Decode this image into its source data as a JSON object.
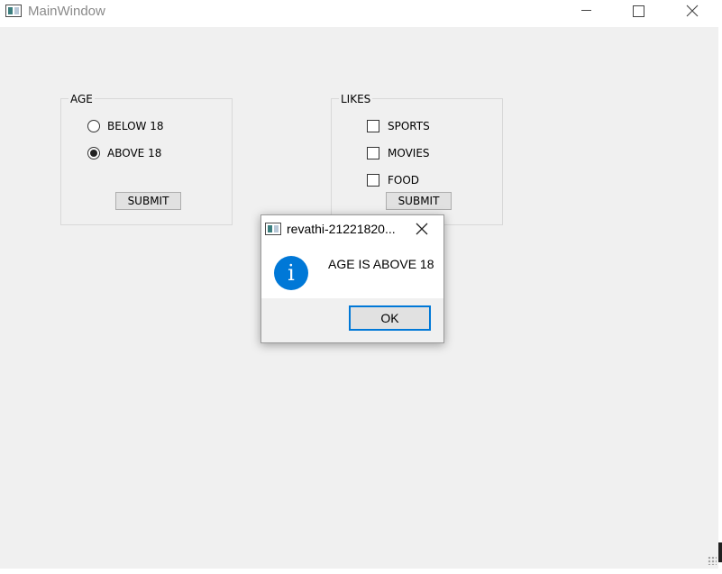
{
  "window": {
    "title": "MainWindow",
    "icon": "app-window-icon"
  },
  "age_group": {
    "title": "AGE",
    "options": [
      {
        "label": "BELOW 18",
        "checked": false
      },
      {
        "label": "ABOVE 18",
        "checked": true
      }
    ],
    "submit_label": "SUBMIT"
  },
  "likes_group": {
    "title": "LIKES",
    "options": [
      {
        "label": "SPORTS",
        "checked": false
      },
      {
        "label": "MOVIES",
        "checked": false
      },
      {
        "label": "FOOD",
        "checked": false
      }
    ],
    "submit_label": "SUBMIT"
  },
  "dialog": {
    "title": "revathi-21221820...",
    "icon": "info-icon",
    "message": "AGE IS ABOVE 18",
    "ok_label": "OK",
    "info_glyph": "i"
  },
  "colors": {
    "accent": "#0078d7",
    "background": "#f0f0f0"
  }
}
